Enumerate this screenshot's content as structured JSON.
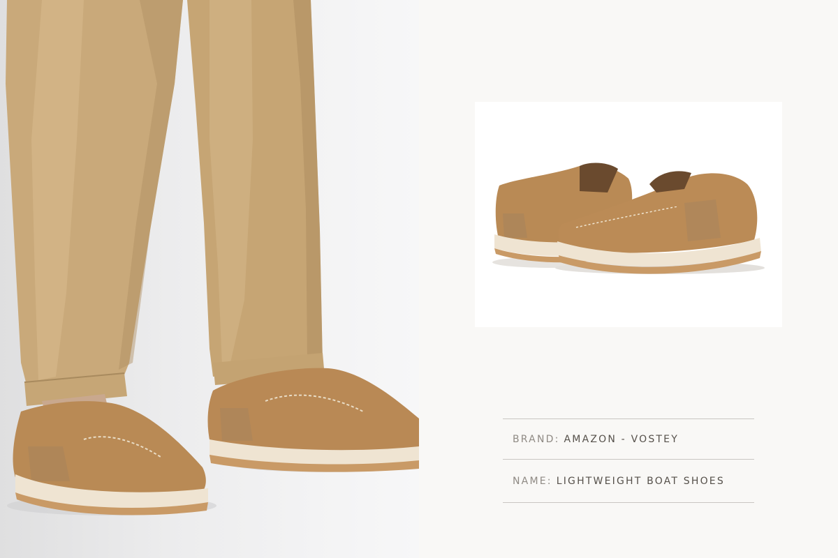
{
  "product": {
    "brand_label": "BRAND:",
    "brand_value": "AMAZON - VOSTEY",
    "name_label": "NAME:",
    "name_value": "LIGHTWEIGHT BOAT SHOES"
  },
  "colors": {
    "background": "#f9f8f6",
    "pants": "#c8a878",
    "shoe_leather": "#b98a55",
    "sole": "#efe4d2",
    "label_text": "#8f8a84",
    "value_text": "#55504a",
    "divider": "#c9c6c2"
  }
}
